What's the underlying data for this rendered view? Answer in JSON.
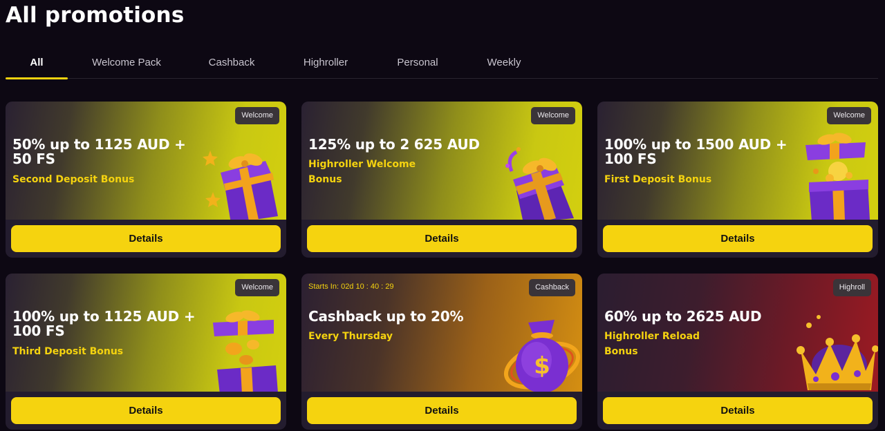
{
  "page": {
    "title": "All promotions"
  },
  "tabs": [
    {
      "label": "All",
      "active": true
    },
    {
      "label": "Welcome Pack",
      "active": false
    },
    {
      "label": "Cashback",
      "active": false
    },
    {
      "label": "Highroller",
      "active": false
    },
    {
      "label": "Personal",
      "active": false
    },
    {
      "label": "Weekly",
      "active": false
    }
  ],
  "colors": {
    "accent": "#f5d30f",
    "background": "#0d0813",
    "card": "#231c2e"
  },
  "promotions": [
    {
      "badge": "Welcome",
      "title": "50% up to 1125 AUD + 50 FS",
      "subtitle": "Second Deposit Bonus",
      "button": "Details",
      "art": "gift-box-icon"
    },
    {
      "badge": "Welcome",
      "title": "125% up to 2 625 AUD",
      "subtitle": "Highroller Welcome Bonus",
      "button": "Details",
      "art": "gift-box-icon"
    },
    {
      "badge": "Welcome",
      "title": "100% up to 1500 AUD + 100 FS",
      "subtitle": "First Deposit Bonus",
      "button": "Details",
      "art": "gift-box-icon"
    },
    {
      "badge": "Welcome",
      "title": "100% up to 1125 AUD + 100 FS",
      "subtitle": "Third Deposit Bonus",
      "button": "Details",
      "art": "gift-box-icon"
    },
    {
      "badge": "Cashback",
      "timer": "Starts In:  02d 10 : 40 : 29",
      "title": "Cashback up to 20%",
      "subtitle": "Every Thursday",
      "button": "Details",
      "art": "money-bag-icon"
    },
    {
      "badge": "Highroll",
      "title": "60% up to 2625 AUD",
      "subtitle": "Highroller Reload Bonus",
      "button": "Details",
      "art": "crown-icon"
    }
  ]
}
